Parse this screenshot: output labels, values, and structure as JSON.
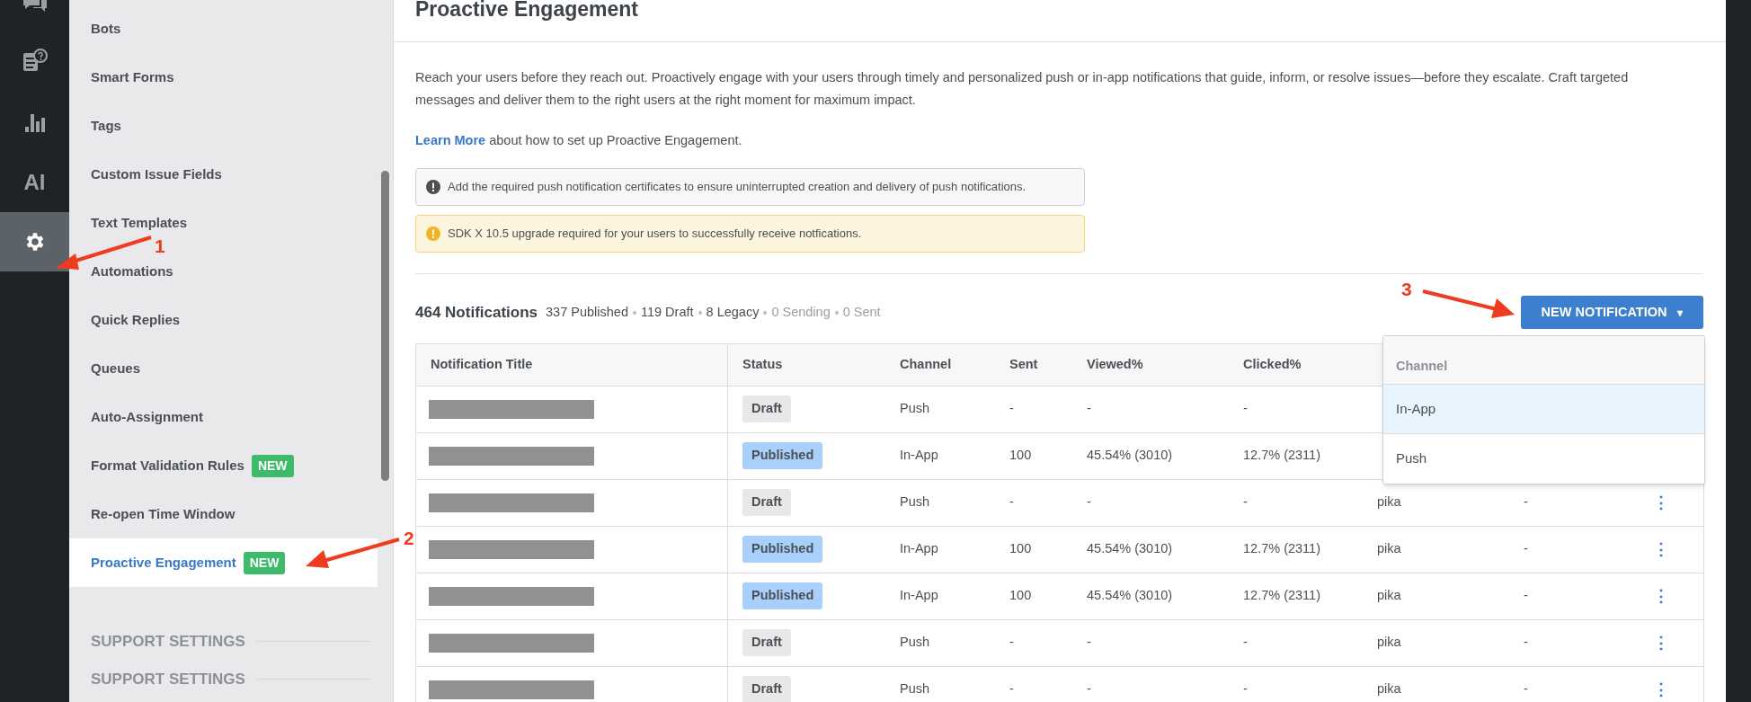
{
  "rail": {
    "items": [
      {
        "kind": "chat",
        "selected": false
      },
      {
        "kind": "help",
        "selected": false
      },
      {
        "kind": "chart",
        "selected": false
      },
      {
        "kind": "text",
        "label": "AI",
        "selected": false
      },
      {
        "kind": "gear",
        "selected": true
      }
    ]
  },
  "sidebar": {
    "items": [
      {
        "label": "Bots",
        "selected": false
      },
      {
        "label": "Smart Forms",
        "selected": false
      },
      {
        "label": "Tags",
        "selected": false
      },
      {
        "label": "Custom Issue Fields",
        "selected": false
      },
      {
        "label": "Text Templates",
        "selected": false
      },
      {
        "label": "Automations",
        "selected": false
      },
      {
        "label": "Quick Replies",
        "selected": false
      },
      {
        "label": "Queues",
        "selected": false
      },
      {
        "label": "Auto-Assignment",
        "selected": false
      },
      {
        "label": "Format Validation Rules",
        "badge": "NEW",
        "selected": false
      },
      {
        "label": "Re-open Time Window",
        "selected": false
      },
      {
        "label": "Proactive Engagement",
        "badge": "NEW",
        "selected": true
      }
    ],
    "sections": [
      "SUPPORT SETTINGS",
      "SUPPORT SETTINGS"
    ]
  },
  "page": {
    "title": "Proactive Engagement",
    "description": "Reach your users before they reach out. Proactively engage with your users through timely and personalized push or in-app notifications that guide, inform, or resolve issues—before they escalate. Craft targeted messages and deliver them to the right users at the right moment for maximum impact.",
    "learn_more": {
      "link": "Learn More",
      "text": "about how to set up Proactive Engagement."
    },
    "alerts": [
      {
        "kind": "info",
        "text": "Add the required push notification certificates to ensure uninterrupted creation and delivery of push notifications."
      },
      {
        "kind": "warning",
        "text": "SDK X 10.5 upgrade required for your users to successfully receive notfications."
      }
    ],
    "summary": {
      "total": "464 Notifications",
      "counts": [
        {
          "text": "337 Published",
          "muted": false
        },
        {
          "text": "119 Draft",
          "muted": false
        },
        {
          "text": "8 Legacy",
          "muted": false
        },
        {
          "text": "0 Sending",
          "muted": true
        },
        {
          "text": "0 Sent",
          "muted": true
        }
      ]
    },
    "new_button": {
      "label": "NEW NOTIFICATION",
      "caret": "▾"
    },
    "dropdown": {
      "heading": "Channel",
      "items": [
        {
          "label": "In-App",
          "selected": true
        },
        {
          "label": "Push",
          "selected": false
        }
      ]
    }
  },
  "table": {
    "columns": [
      "Notification Title",
      "Status",
      "Channel",
      "Sent",
      "Viewed%",
      "Clicked%"
    ],
    "rows": [
      {
        "status": "Draft",
        "kind": "draft",
        "channel": "Push",
        "sent": "-",
        "viewed": "-",
        "clicked": "-"
      },
      {
        "status": "Published",
        "kind": "published",
        "channel": "In-App",
        "sent": "100",
        "viewed": "45.54% (3010)",
        "clicked": "12.7% (2311)"
      },
      {
        "status": "Draft",
        "kind": "draft",
        "channel": "Push",
        "sent": "-",
        "viewed": "-",
        "clicked": "-",
        "column_7": "pika",
        "column_8": "-",
        "menu": "⋮"
      },
      {
        "status": "Published",
        "kind": "published",
        "channel": "In-App",
        "sent": "100",
        "viewed": "45.54% (3010)",
        "clicked": "12.7% (2311)",
        "column_7": "pika",
        "column_8": "-",
        "menu": "⋮"
      },
      {
        "status": "Published",
        "kind": "published",
        "channel": "In-App",
        "sent": "100",
        "viewed": "45.54% (3010)",
        "clicked": "12.7% (2311)",
        "column_7": "pika",
        "column_8": "-",
        "menu": "⋮"
      },
      {
        "status": "Draft",
        "kind": "draft",
        "channel": "Push",
        "sent": "-",
        "viewed": "-",
        "clicked": "-",
        "column_7": "pika",
        "column_8": "-",
        "menu": "⋮"
      },
      {
        "status": "Draft",
        "kind": "draft",
        "channel": "Push",
        "sent": "-",
        "viewed": "-",
        "clicked": "-",
        "column_7": "pika",
        "column_8": "-",
        "menu": "⋮"
      }
    ]
  },
  "annotations": [
    "1",
    "2",
    "3"
  ]
}
